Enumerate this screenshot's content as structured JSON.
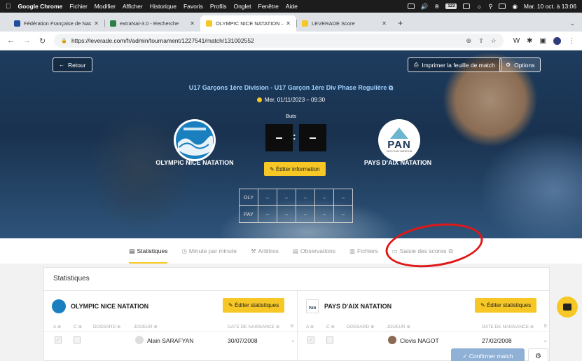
{
  "menubar": {
    "app": "Google Chrome",
    "items": [
      "Fichier",
      "Modifier",
      "Afficher",
      "Historique",
      "Favoris",
      "Profils",
      "Onglet",
      "Fenêtre",
      "Aide"
    ],
    "battery_badge": "123",
    "clock": "Mar. 10 oct. à 13:06"
  },
  "tabs": [
    {
      "label": "Fédération Française de Natation",
      "color": "#1f4e9c"
    },
    {
      "label": "extraNat-3.0 - Recherche",
      "color": "#2d7d46"
    },
    {
      "label": "OLYMPIC NICE NATATION – PAYS",
      "color": "#f7c825"
    },
    {
      "label": "LEVERADE Score",
      "color": "#f7c825"
    }
  ],
  "address": {
    "url": "https://leverade.com/fr/admin/tournament/1227541/match/131002552"
  },
  "hero": {
    "back_label": "Retour",
    "print_label": "Imprimer la feuille de match",
    "options_label": "Options",
    "title": "U17 Garçons 1ère Division - U17 Garçon 1ère Div Phase Regulière",
    "date": "Mer, 01/11/2023 – 09:30",
    "goals_label": "Buts",
    "score_home": "–",
    "score_away": "–",
    "score_sep": ":",
    "home_team": "OLYMPIC NICE NATATION",
    "away_team": "PAYS D'AIX NATATION",
    "away_logo_text": "PAN",
    "away_logo_sub": "PAYS D'AIX NATATION",
    "edit_info_label": "Éditer information",
    "quarters": {
      "rows": [
        {
          "label": "OLY",
          "cells": [
            "–",
            "–",
            "–",
            "–",
            "–"
          ]
        },
        {
          "label": "PAY",
          "cells": [
            "–",
            "–",
            "–",
            "–",
            "–"
          ]
        }
      ]
    }
  },
  "subtabs": [
    {
      "label": "Statistiques",
      "icon": "chart-icon"
    },
    {
      "label": "Minute par minute",
      "icon": "clock-icon"
    },
    {
      "label": "Arbitres",
      "icon": "whistle-icon"
    },
    {
      "label": "Observations",
      "icon": "document-icon"
    },
    {
      "label": "Fichiers",
      "icon": "file-icon"
    },
    {
      "label": "Saisie des scores",
      "icon": "monitor-icon"
    }
  ],
  "stats": {
    "title": "Statistiques",
    "edit_label": "Éditer statistiques",
    "home": {
      "name": "OLYMPIC NICE NATATION",
      "headers": [
        "A",
        "C",
        "DOSSARD",
        "JOUEUR",
        "DATE DE NAISSANCE",
        "B"
      ],
      "row": {
        "player": "Alain SARAFYAN",
        "birth": "30/07/2008",
        "extra": "-"
      }
    },
    "away": {
      "name": "PAYS D'AIX NATATION",
      "logo_text": "PAN",
      "headers": [
        "A",
        "C",
        "DOSSARD",
        "JOUEUR",
        "DATE DE NAISSANCE",
        "E"
      ],
      "row": {
        "player": "Clovis NAGOT",
        "birth": "27/02/2008",
        "extra": "-"
      }
    }
  },
  "footer": {
    "confirm_label": "Confirmer match"
  },
  "colors": {
    "accent": "#f7c825",
    "title": "#9fd0ff",
    "confirm": "#8fb1d6",
    "annotation": "#e01818"
  }
}
